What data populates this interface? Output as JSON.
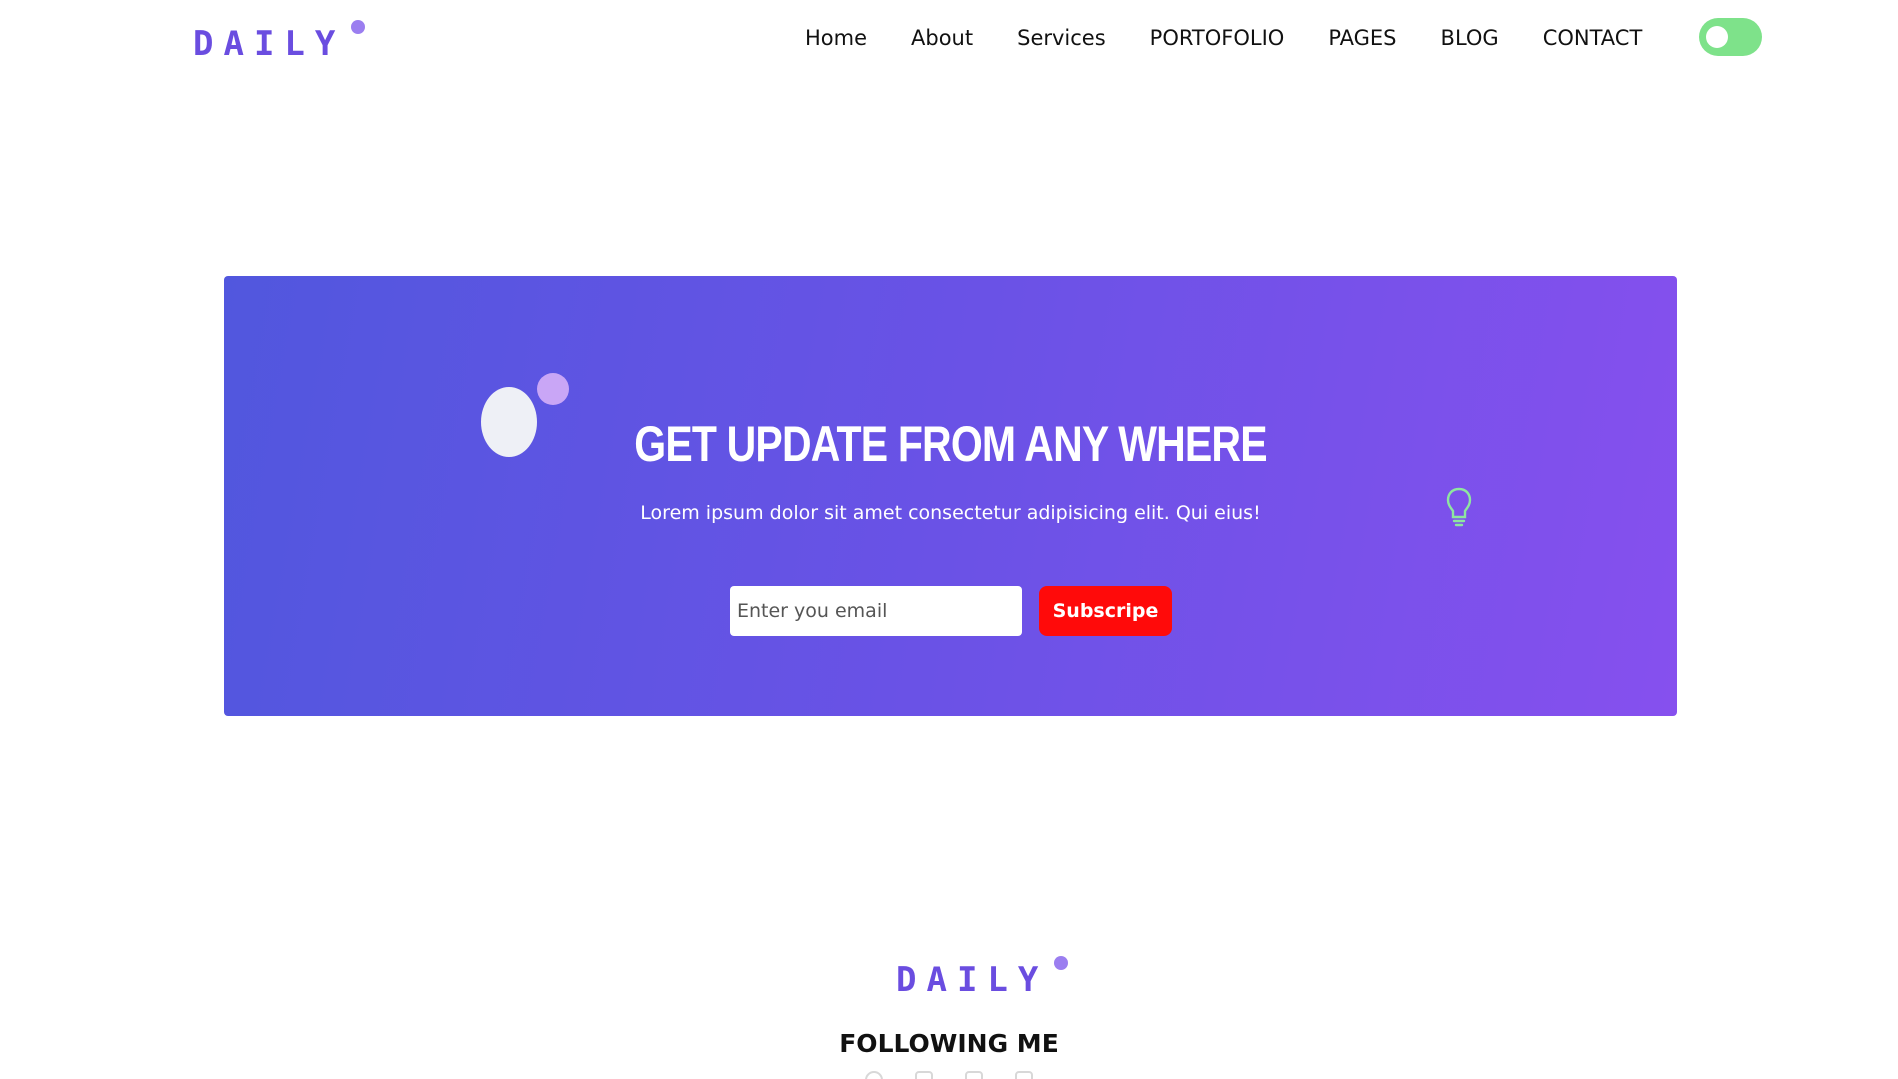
{
  "header": {
    "logo_text": "DAILY",
    "nav": [
      {
        "label": "Home"
      },
      {
        "label": "About"
      },
      {
        "label": "Services"
      },
      {
        "label": "PORTOFOLIO"
      },
      {
        "label": "PAGES"
      },
      {
        "label": "BLOG"
      },
      {
        "label": "CONTACT"
      }
    ],
    "theme_toggle": {
      "icon": "toggle-switch",
      "color": "#7ee28a"
    }
  },
  "banner": {
    "title": "GET UPDATE FROM ANY WHERE",
    "subtitle": "Lorem ipsum dolor sit amet consectetur adipisicing elit. Qui eius!",
    "email_placeholder": "Enter you email",
    "email_value": "",
    "subscribe_label": "Subscripe",
    "decor_icon": "lightbulb-icon",
    "gradient_start": "#5157de",
    "gradient_end": "#8650ee",
    "button_color": "#ff0a0a"
  },
  "footer": {
    "logo_text": "DAILY",
    "heading": "FOLLOWING ME",
    "social_icons": [
      "social-icon",
      "social-icon",
      "social-icon",
      "social-icon"
    ]
  },
  "brand_color": "#6a4de0"
}
